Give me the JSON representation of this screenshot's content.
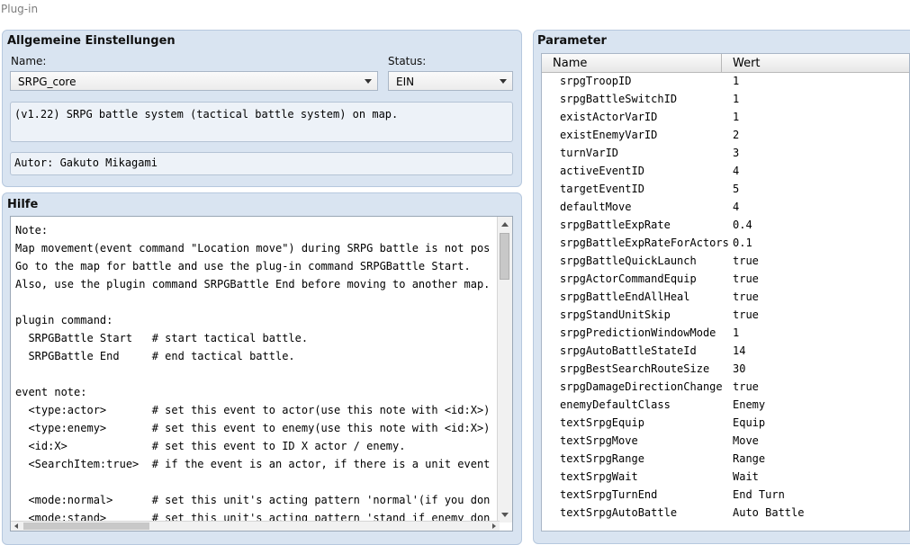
{
  "window": {
    "title": "Plug-in"
  },
  "general": {
    "heading": "Allgemeine Einstellungen",
    "name_label": "Name:",
    "name_value": "SRPG_core",
    "status_label": "Status:",
    "status_value": "EIN",
    "description": "(v1.22) SRPG battle system (tactical battle system) on map.",
    "author": "Autor: Gakuto Mikagami"
  },
  "help": {
    "heading": "Hilfe",
    "text": "Note:\nMap movement(event command \"Location move\") during SRPG battle is not possible\nGo to the map for battle and use the plug-in command SRPGBattle Start.\nAlso, use the plugin command SRPGBattle End before moving to another map.\n\nplugin command:\n  SRPGBattle Start   # start tactical battle.\n  SRPGBattle End     # end tactical battle.\n\nevent note:\n  <type:actor>       # set this event to actor(use this note with <id:X>).\n  <type:enemy>       # set this event to enemy(use this note with <id:X>).\n  <id:X>             # set this event to ID X actor / enemy.\n  <SearchItem:true>  # if the event is an actor, if there is a unit event, it w\n\n  <mode:normal>      # set this unit's acting pattern 'normal'(if you don't se\n  <mode:stand>       # set this unit's acting pattern 'stand if enemy don't ne"
  },
  "parameters": {
    "heading": "Parameter",
    "col_name": "Name",
    "col_value": "Wert",
    "rows": [
      {
        "name": "srpgTroopID",
        "value": "1"
      },
      {
        "name": "srpgBattleSwitchID",
        "value": "1"
      },
      {
        "name": "existActorVarID",
        "value": "1"
      },
      {
        "name": "existEnemyVarID",
        "value": "2"
      },
      {
        "name": "turnVarID",
        "value": "3"
      },
      {
        "name": "activeEventID",
        "value": "4"
      },
      {
        "name": "targetEventID",
        "value": "5"
      },
      {
        "name": "defaultMove",
        "value": "4"
      },
      {
        "name": "srpgBattleExpRate",
        "value": "0.4"
      },
      {
        "name": "srpgBattleExpRateForActors",
        "value": "0.1"
      },
      {
        "name": "srpgBattleQuickLaunch",
        "value": "true"
      },
      {
        "name": "srpgActorCommandEquip",
        "value": "true"
      },
      {
        "name": "srpgBattleEndAllHeal",
        "value": "true"
      },
      {
        "name": "srpgStandUnitSkip",
        "value": "true"
      },
      {
        "name": "srpgPredictionWindowMode",
        "value": "1"
      },
      {
        "name": "srpgAutoBattleStateId",
        "value": "14"
      },
      {
        "name": "srpgBestSearchRouteSize",
        "value": "30"
      },
      {
        "name": "srpgDamageDirectionChange",
        "value": "true"
      },
      {
        "name": "enemyDefaultClass",
        "value": "Enemy"
      },
      {
        "name": "textSrpgEquip",
        "value": "Equip"
      },
      {
        "name": "textSrpgMove",
        "value": "Move"
      },
      {
        "name": "textSrpgRange",
        "value": "Range"
      },
      {
        "name": "textSrpgWait",
        "value": "Wait"
      },
      {
        "name": "textSrpgTurnEnd",
        "value": "End Turn"
      },
      {
        "name": "textSrpgAutoBattle",
        "value": "Auto Battle"
      }
    ]
  }
}
